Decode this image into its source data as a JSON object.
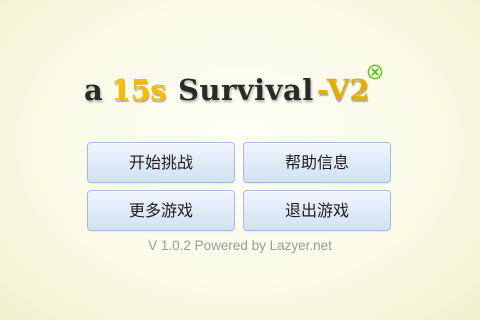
{
  "title": {
    "prefix": "a",
    "duration": "15s",
    "word": "Survival",
    "version": "-V2",
    "badge_icon": "x-circle-icon"
  },
  "menu": {
    "start_label": "开始挑战",
    "help_label": "帮助信息",
    "more_games_label": "更多游戏",
    "exit_label": "退出游戏"
  },
  "footer": {
    "version_text": "V 1.0.2 Powered by Lazyer.net"
  },
  "colors": {
    "bg": "#fbfbe8",
    "title-dark": "#2a2a2a",
    "accent-num": "#f0c000",
    "accent-ver": "#e6ab00",
    "badge": "#6cbd2b",
    "btn-border": "#a3bcd9",
    "btn-text": "#1e1e1e",
    "footer": "#9a9a9a"
  }
}
